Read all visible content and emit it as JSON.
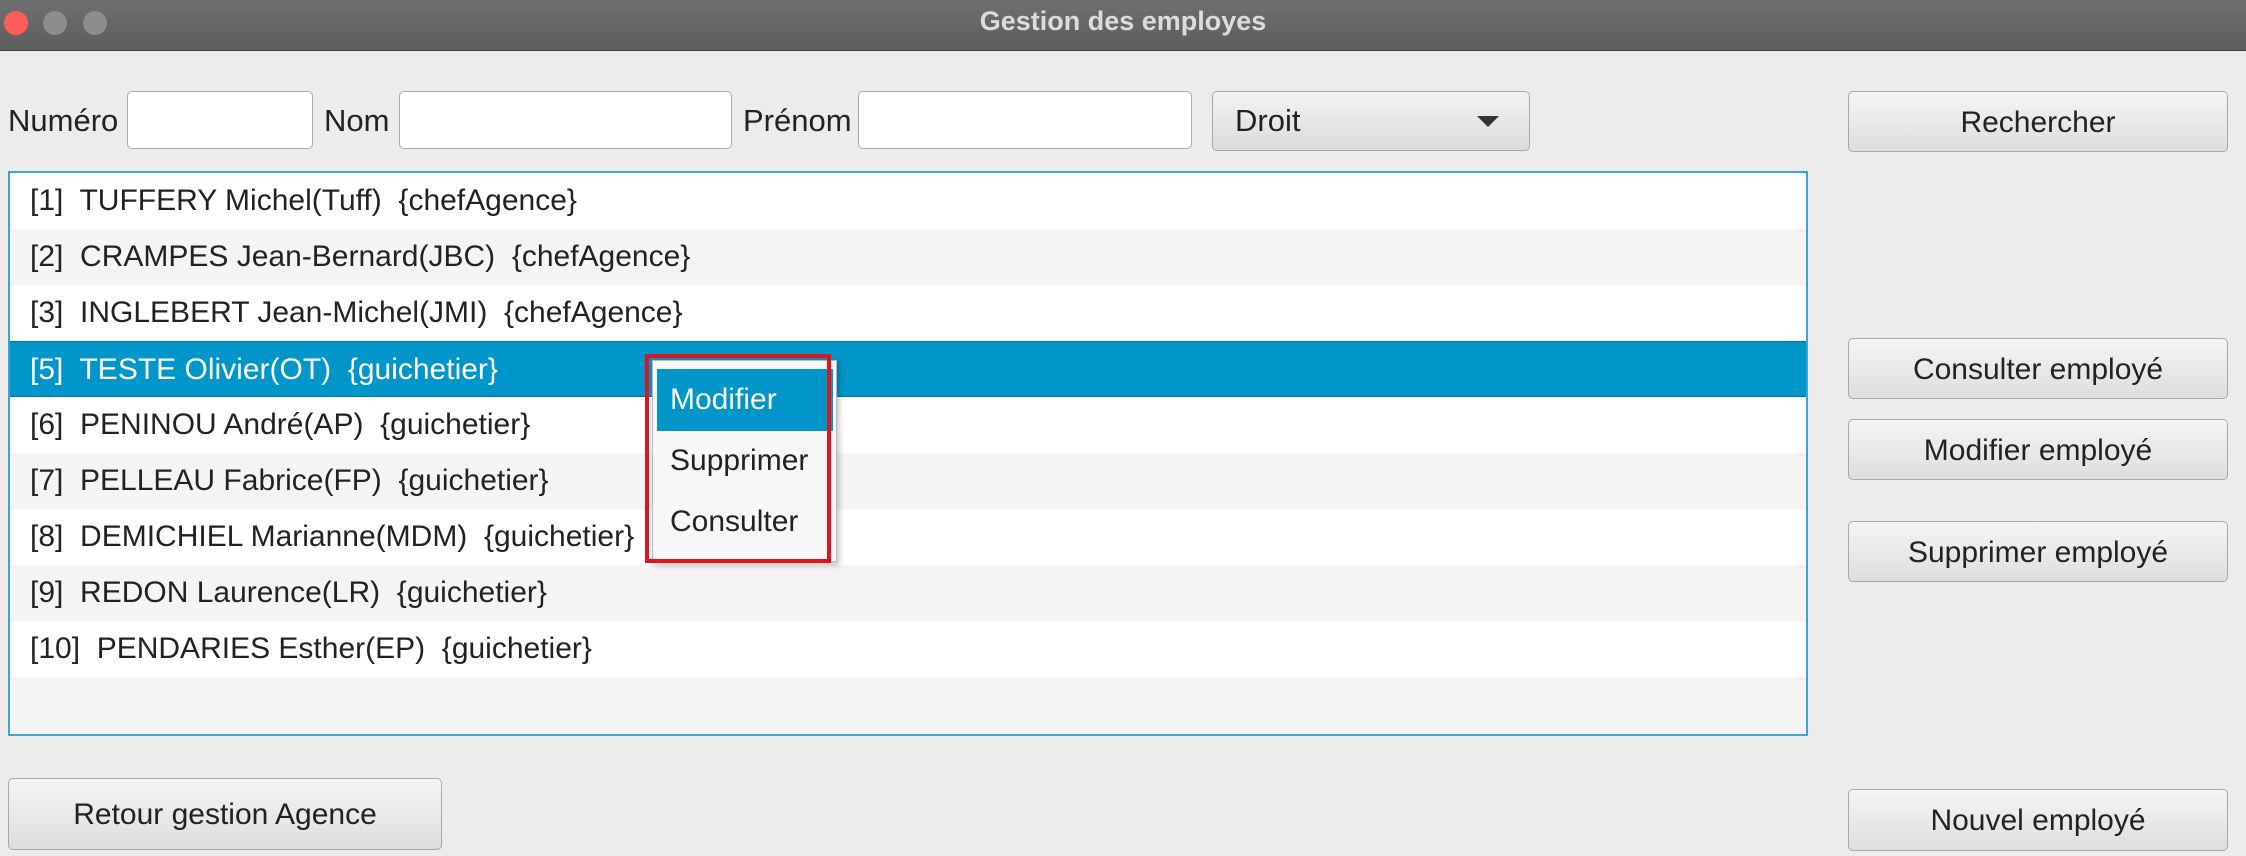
{
  "window": {
    "title": "Gestion des employes"
  },
  "search": {
    "numero_label": "Numéro",
    "numero_value": "",
    "nom_label": "Nom",
    "nom_value": "",
    "prenom_label": "Prénom",
    "prenom_value": "",
    "droit_selected": "Droit",
    "search_button": "Rechercher"
  },
  "employees": [
    "[1]  TUFFERY Michel(Tuff)  {chefAgence}",
    "[2]  CRAMPES Jean-Bernard(JBC)  {chefAgence}",
    "[3]  INGLEBERT Jean-Michel(JMI)  {chefAgence}",
    "[5]  TESTE Olivier(OT)  {guichetier}",
    "[6]  PENINOU André(AP)  {guichetier}",
    "[7]  PELLEAU Fabrice(FP)  {guichetier}",
    "[8]  DEMICHIEL Marianne(MDM)  {guichetier}",
    "[9]  REDON Laurence(LR)  {guichetier}",
    "[10]  PENDARIES Esther(EP)  {guichetier}"
  ],
  "selected_index": 3,
  "context_menu": {
    "items": [
      "Modifier",
      "Supprimer",
      "Consulter"
    ],
    "active_index": 0
  },
  "actions": {
    "consulter": "Consulter employé",
    "modifier": "Modifier employé",
    "supprimer": "Supprimer employé",
    "nouvel": "Nouvel employé",
    "retour": "Retour gestion Agence"
  },
  "colors": {
    "selection": "#0096c9",
    "list_border": "#3aa5d8",
    "highlight_box": "#e0141e"
  }
}
